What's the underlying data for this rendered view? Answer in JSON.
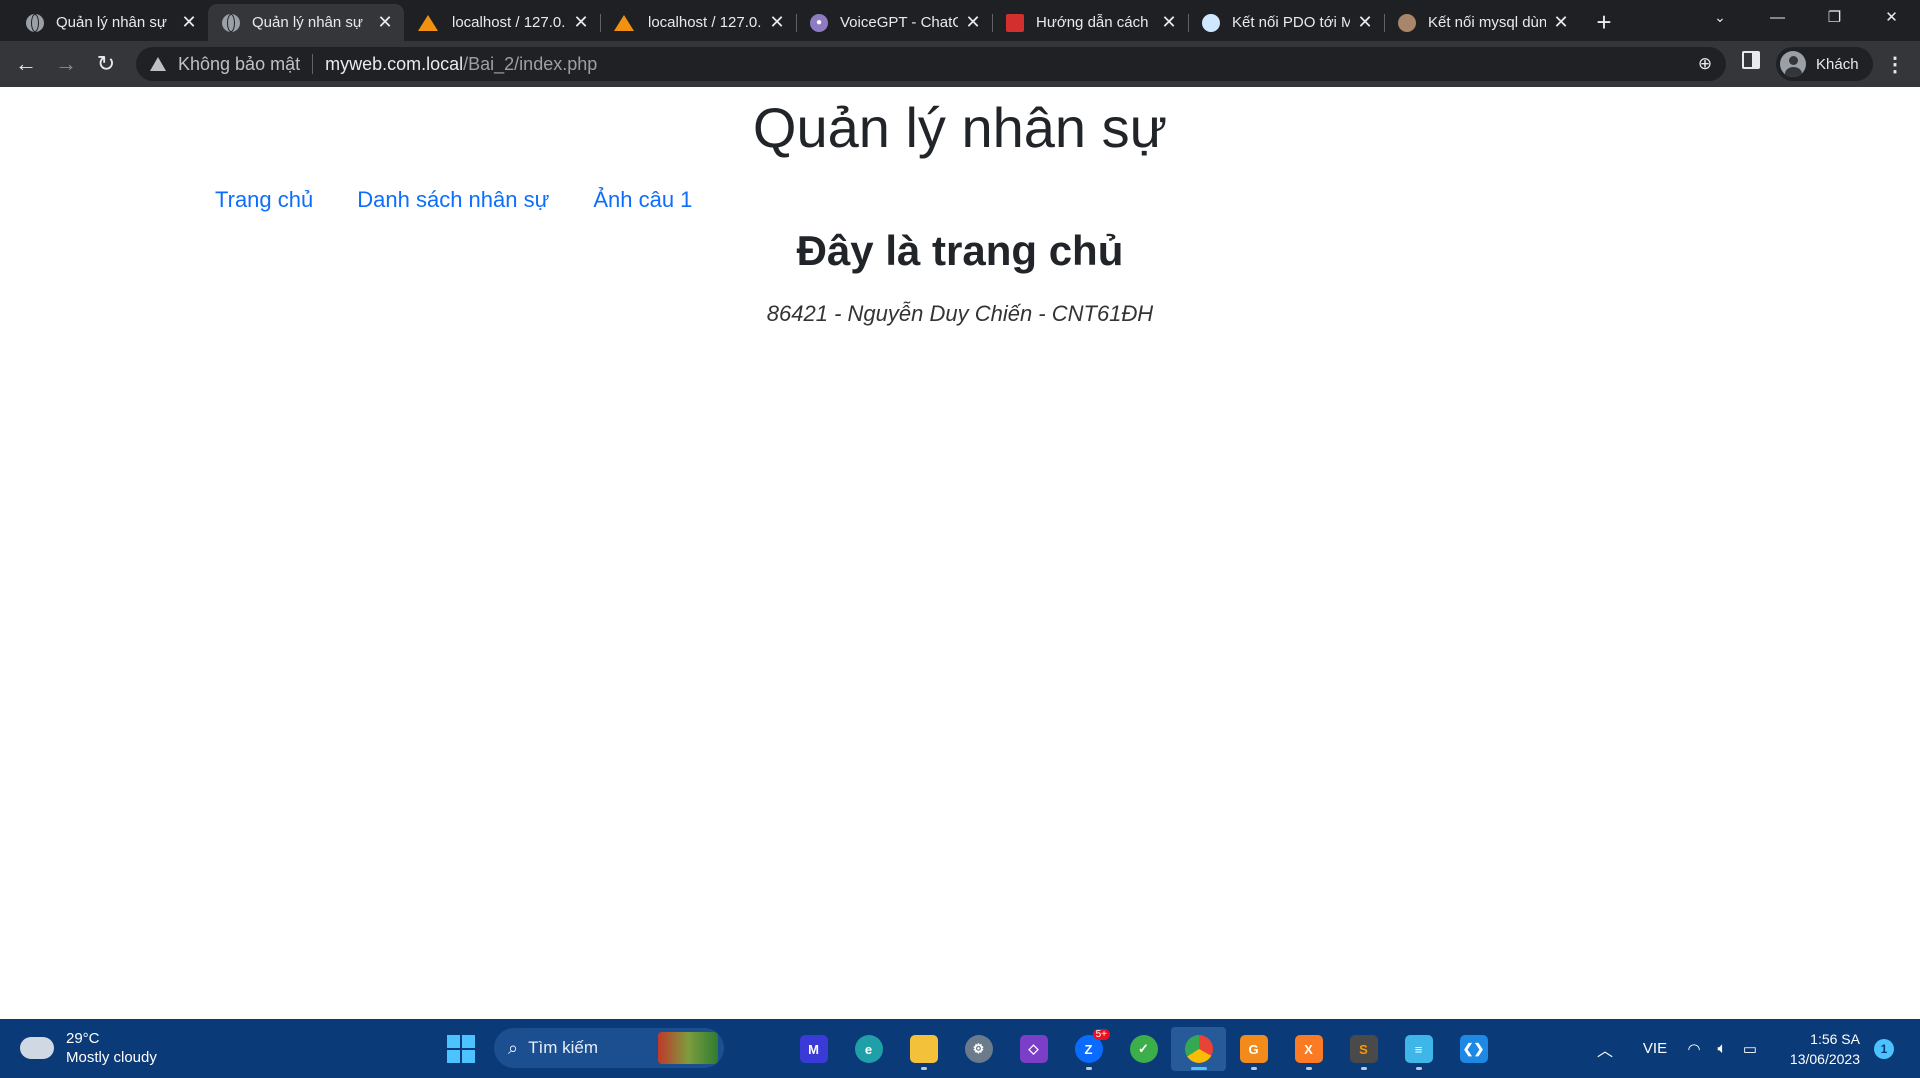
{
  "browser": {
    "tabs": [
      {
        "title": "Quản lý nhân sự",
        "icon": "globe-icon",
        "active": false
      },
      {
        "title": "Quản lý nhân sự",
        "icon": "globe-icon",
        "active": true
      },
      {
        "title": "localhost / 127.0.",
        "icon": "phpmyadmin-icon",
        "active": false
      },
      {
        "title": "localhost / 127.0.",
        "icon": "phpmyadmin-icon",
        "active": false
      },
      {
        "title": "VoiceGPT - ChatG",
        "icon": "voicegpt-icon",
        "active": false
      },
      {
        "title": "Hướng dẫn cách",
        "icon": "site-icon",
        "active": false
      },
      {
        "title": "Kết nối PDO tới M",
        "icon": "pdo-site-icon",
        "active": false
      },
      {
        "title": "Kết nối mysql dùn",
        "icon": "profile-photo-icon",
        "active": false
      }
    ],
    "new_tab": "+",
    "security_label": "Không bảo mật",
    "url_host": "myweb.com.local",
    "url_path": "/Bai_2/index.php",
    "profile_label": "Khách"
  },
  "page": {
    "site_title": "Quản lý nhân sự",
    "nav": [
      {
        "label": "Trang chủ"
      },
      {
        "label": "Danh sách nhân sự"
      },
      {
        "label": "Ảnh câu 1"
      }
    ],
    "heading": "Đây là trang chủ",
    "student_info": "86421 - Nguyễn Duy Chiến - CNT61ĐH",
    "link_color": "#0d6efd"
  },
  "taskbar": {
    "weather_temp": "29°C",
    "weather_desc": "Mostly cloudy",
    "search_label": "Tìm kiếm",
    "zalo_badge": "5+",
    "language": "VIE",
    "time": "1:56 SA",
    "date": "13/06/2023",
    "notification_count": "1"
  }
}
